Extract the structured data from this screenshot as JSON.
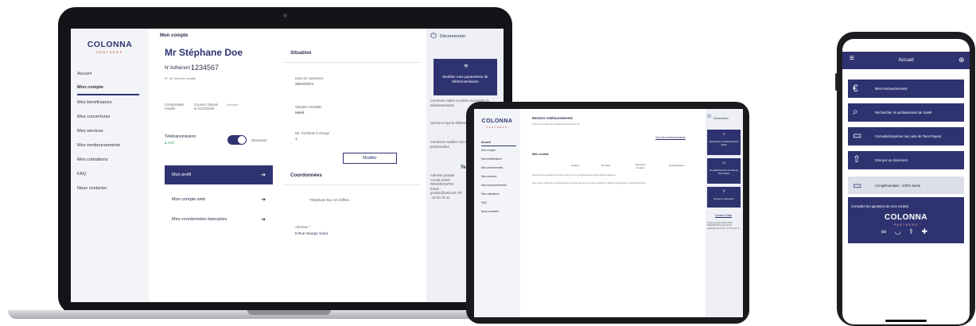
{
  "laptop": {
    "brand": "COLONNA",
    "brand_sub": "PARTNERS",
    "nav": [
      "Accueil",
      "Mon compte",
      "Mes bénéficiaires",
      "Mes couvertures",
      "Mes services",
      "Mes remboursements",
      "Mes cotisations",
      "FAQ",
      "Nous contacter"
    ],
    "breadcrumb": "Mon compte",
    "name": "Mr Stéphane Doe",
    "adherent_label": "N°Adhérent :",
    "adherent_number": "1234567",
    "secu_label": "N° de Sécurité sociale",
    "contract_left": "Contrat Base Famille",
    "contract_mid": "Couvert. Depuis le 01/10/2019",
    "contract_right": "Voucher",
    "teletransmission": "Télétransmission",
    "teletransmission_status": "● Actif",
    "toggle_label": "Désactiver",
    "menu": [
      "Mon profil",
      "Mon compte web",
      "Mes coordonnées bancaires"
    ],
    "situation_title": "Situation",
    "fields": [
      {
        "label": "Date de naissance",
        "value": "29/10/1974"
      },
      {
        "label": "Situation familiale",
        "value": "Marié"
      },
      {
        "label": "Nb. d'enfants à charge",
        "value": "1"
      }
    ],
    "modify_label": "Modifier",
    "coord_title": "Coordonnées",
    "phone_text": "Téléphone fixe 10 chiffres",
    "address_label": "Adresse *",
    "address_value": "8 Rue George Sand",
    "disconnect": "Déconnexion",
    "tele_block": "Modifier mes paramètres de télétransmission",
    "right_texts": [
      "Comment mettre en place ou annuler la télétransmission",
      "Qu'est-ce que la télétransmission ?",
      "Comment modifier vos coordonnées personnelles"
    ],
    "right_bold": "Te",
    "right_contact": "Adresse postale CSAM 41097 ROMORANTIN Email : gestion@colonna Tél : 02 54 76 41"
  },
  "tablet": {
    "brand": "COLONNA",
    "brand_sub": "PARTNERS",
    "nav": [
      "Accueil",
      "Mon compte",
      "Mes bénéficiaires",
      "Mes abonnements",
      "Mes services",
      "Mes remboursements",
      "Mes cotisations",
      "FAQ",
      "Nous contacter"
    ],
    "title": "Derniers remboursements",
    "subtitle": "Vous n'avez pas de remboursements récents",
    "all_link": "Tous les remboursements",
    "contract_title": "Mon contrat",
    "pills": [
      "Optique",
      "Dentaire",
      "Médecine courante",
      "Hospitalisation"
    ],
    "note1": "Découvrez les garanties de votre contrat pour vos remboursements dans chaque catégorie.",
    "note2": "Pour avoir le détail des remboursements de santé de tous vos postes consultez le tableau des garanties et remboursements.",
    "disconnect": "Déconnexion",
    "right_blocks": [
      "Rechercher un professionnel de Santé",
      "Consulter/imprimer ma carte de Tiers Payant",
      "Envoyer un document"
    ],
    "right_link": "Contact & Aide",
    "right_text": "Adresse postale CSAM 41097 ROMORANTIN Cedex Email : gestion@colonna Tél : 02 54 76 41 11"
  },
  "phone": {
    "title": "Accueil",
    "items": [
      "Mes remboursements",
      "Rechercher un professionnel de Santé",
      "Consulter/imprimer ma carte de Tiers Payant",
      "Envoyer un document"
    ],
    "icons": [
      "euro-icon",
      "search-icon",
      "card-icon",
      "upload-icon"
    ],
    "mutual": "Complémentaire : 100% Santé",
    "card_text": "Consulter les garanties de mon contrat",
    "brand": "COLONNA",
    "brand_sub": "PARTNERS",
    "card_icons": "∞ ◡ ⚕ ✚"
  },
  "colors": {
    "brand": "#2e3370",
    "accent": "#c0392b"
  }
}
